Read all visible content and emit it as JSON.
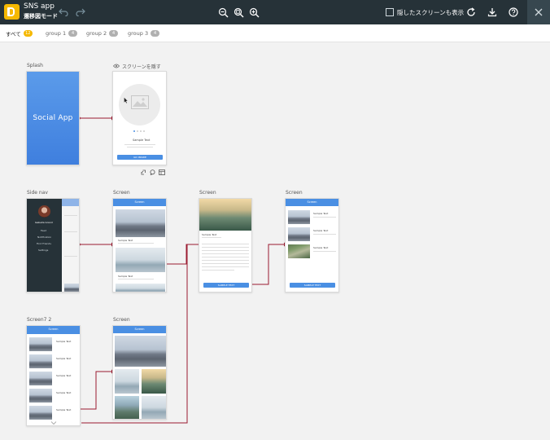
{
  "app": {
    "name": "SNS app",
    "mode": "遷移図モード"
  },
  "toolbar": {
    "undo_icon": "undo-icon",
    "redo_icon": "redo-icon",
    "zoom_out_icon": "zoom-out-icon",
    "zoom_fit_icon": "zoom-fit-icon",
    "zoom_in_icon": "zoom-in-icon",
    "show_hidden_label": "隠したスクリーンも表示",
    "show_hidden_checked": false,
    "refresh_icon": "refresh-icon",
    "download_icon": "download-icon",
    "help_icon": "help-icon",
    "close_icon": "close-icon"
  },
  "tabs": [
    {
      "label": "すべて",
      "count": "12",
      "active": true
    },
    {
      "label": "group 1",
      "count": "4",
      "active": false
    },
    {
      "label": "group 2",
      "count": "4",
      "active": false
    },
    {
      "label": "group 3",
      "count": "4",
      "active": false
    }
  ],
  "screens": {
    "splash": {
      "label": "Splash",
      "title": "Social App"
    },
    "walkthrough": {
      "hide_label": "スクリーンを隠す",
      "sample_text": "Sample Text",
      "button": "GO INSIDE"
    },
    "side_nav": {
      "label": "Side nav",
      "user_name": "Isabella Grand",
      "menu": [
        "Feed",
        "Notification",
        "Find Friends",
        "Settings"
      ]
    },
    "screen_feed": {
      "label": "Screen",
      "header": "Screen",
      "sample_text": "Sample Text"
    },
    "screen_detail": {
      "label": "Screen",
      "sample_text": "Sample Text",
      "button": "SAMPLE TEXT"
    },
    "screen_list": {
      "label": "Screen",
      "header": "Screen",
      "sample_text": "Sample Text",
      "button": "SAMPLE TEXT"
    },
    "screen7_2": {
      "label": "Screen7 2",
      "header": "Screen",
      "sample_text": "Sample Text"
    },
    "screen_gallery": {
      "label": "Screen",
      "header": "Screen"
    }
  },
  "colors": {
    "topbar": "#263238",
    "accent": "#f5b800",
    "primary": "#4a8fe3",
    "connector": "#9b1b30"
  }
}
